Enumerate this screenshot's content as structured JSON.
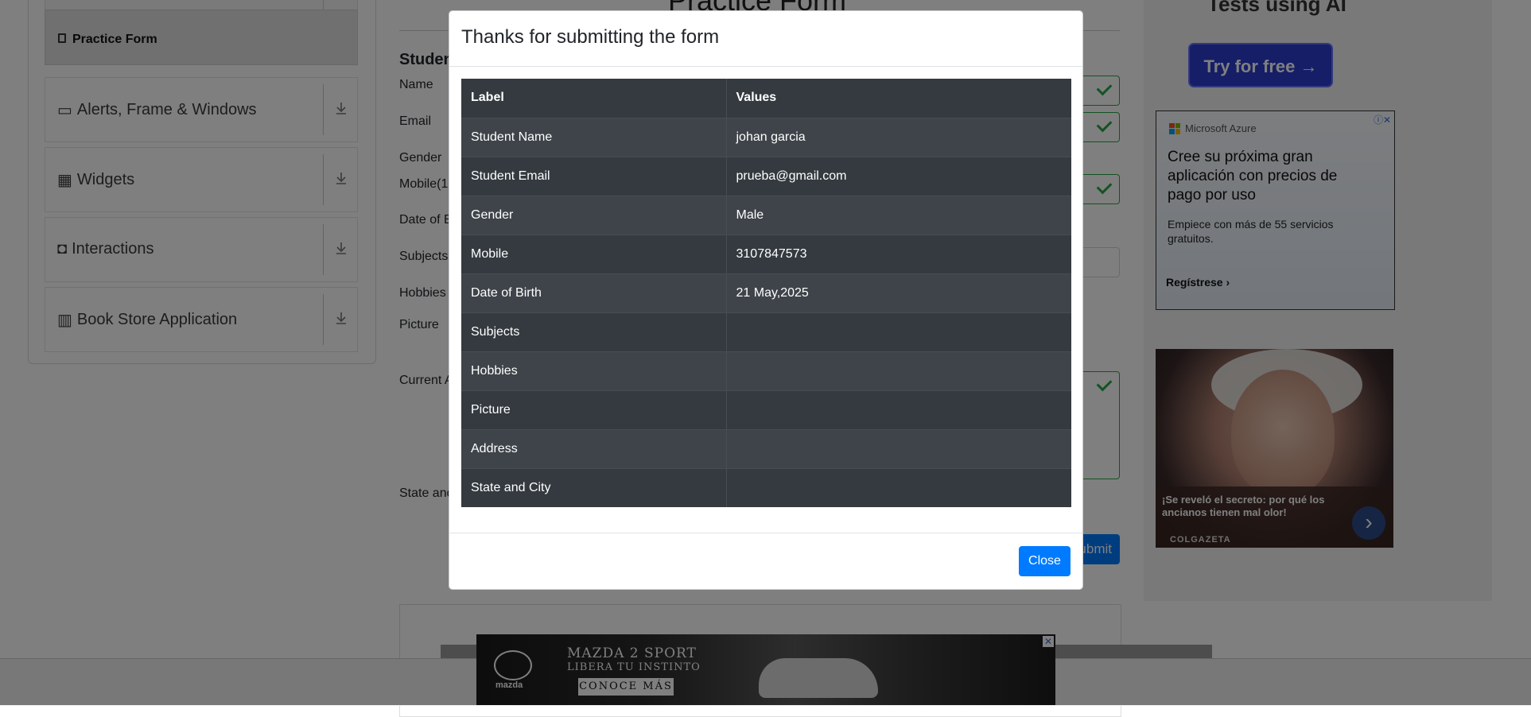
{
  "sidebar": {
    "practice_form": "Practice Form",
    "groups": [
      {
        "label": "Alerts, Frame & Windows"
      },
      {
        "label": "Widgets"
      },
      {
        "label": "Interactions"
      },
      {
        "label": "Book Store Application"
      }
    ]
  },
  "form": {
    "title": "Practice Form",
    "section_partial": "Studen",
    "labels": {
      "name": "Name",
      "email": "Email",
      "gender": "Gender",
      "mobile": "Mobile(1(",
      "dob": "Date of B",
      "subjects": "Subjects",
      "hobbies": "Hobbies",
      "picture": "Picture",
      "current_address": "Current A",
      "state_city": "State and"
    },
    "submit_partial": "ubmit"
  },
  "ads": {
    "top_text": "Tests using AI",
    "try_button": "Try for free →",
    "azure": {
      "brand": "Microsoft Azure",
      "headline": "Cree su próxima gran aplicación con precios de pago por uso",
      "sub": "Empiece con más de 55 servicios gratuitos.",
      "cta": "Regístrese ›"
    },
    "photo": {
      "caption": "¡Se reveló el secreto: por qué los ancianos tienen mal olor!",
      "publisher": "COLGAZETA"
    },
    "mazda": {
      "line1": "MAZDA 2 SPORT",
      "line2": "LIBERA TU INSTINTO",
      "button": "CONOCE MÁS",
      "logo_text": "mazda"
    }
  },
  "modal": {
    "title": "Thanks for submitting the form",
    "columns": [
      "Label",
      "Values"
    ],
    "rows": [
      {
        "label": "Student Name",
        "value": "johan garcia"
      },
      {
        "label": "Student Email",
        "value": "prueba@gmail.com"
      },
      {
        "label": "Gender",
        "value": "Male"
      },
      {
        "label": "Mobile",
        "value": "3107847573"
      },
      {
        "label": "Date of Birth",
        "value": "21 May,2025"
      },
      {
        "label": "Subjects",
        "value": ""
      },
      {
        "label": "Hobbies",
        "value": ""
      },
      {
        "label": "Picture",
        "value": ""
      },
      {
        "label": "Address",
        "value": ""
      },
      {
        "label": "State and City",
        "value": ""
      }
    ],
    "close_label": "Close"
  }
}
